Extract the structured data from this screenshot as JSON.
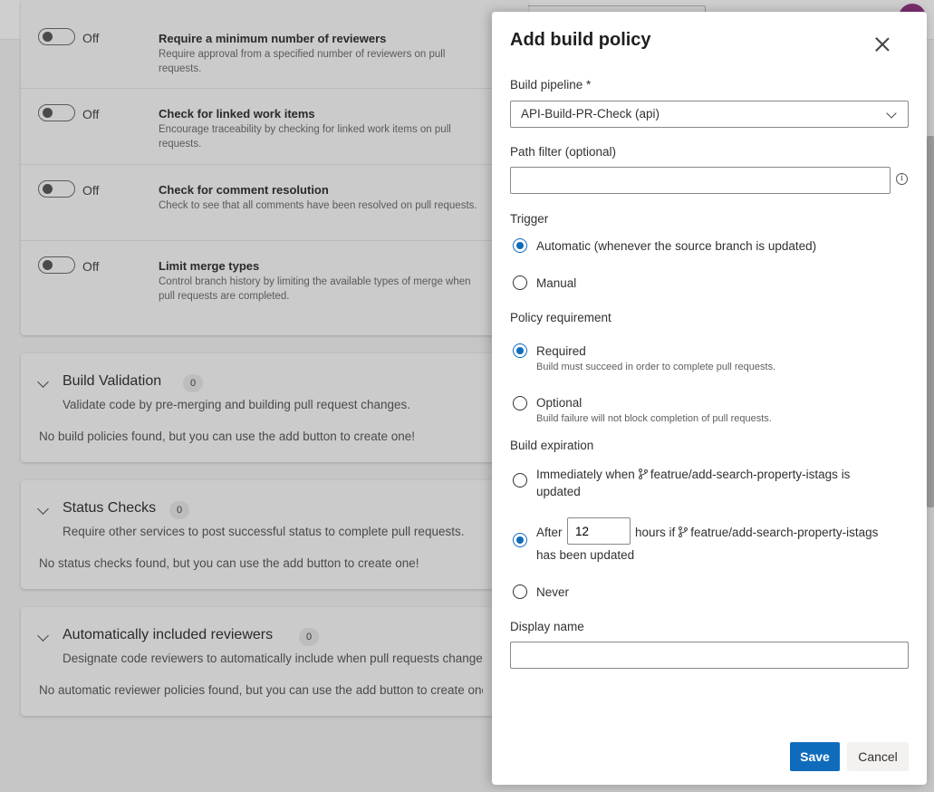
{
  "background": {
    "policies": [
      {
        "state": "Off",
        "title": "Require a minimum number of reviewers",
        "desc": "Require approval from a specified number of reviewers on pull requests."
      },
      {
        "state": "Off",
        "title": "Check for linked work items",
        "desc": "Encourage traceability by checking for linked work items on pull requests."
      },
      {
        "state": "Off",
        "title": "Check for comment resolution",
        "desc": "Check to see that all comments have been resolved on pull requests."
      },
      {
        "state": "Off",
        "title": "Limit merge types",
        "desc": "Control branch history by limiting the available types of merge when pull requests are completed."
      }
    ],
    "sections": [
      {
        "title": "Build Validation",
        "count": "0",
        "desc": "Validate code by pre-merging and building pull request changes.",
        "empty": "No build policies found, but you can use the add button to create one!"
      },
      {
        "title": "Status Checks",
        "count": "0",
        "desc": "Require other services to post successful status to complete pull requests.",
        "empty": "No status checks found, but you can use the add button to create one!"
      },
      {
        "title": "Automatically included reviewers",
        "count": "0",
        "desc": "Designate code reviewers to automatically include when pull requests change",
        "empty": "No automatic reviewer policies found, but you can use the add button to create one!"
      }
    ]
  },
  "dialog": {
    "title": "Add build policy",
    "build_pipeline_label": "Build pipeline *",
    "build_pipeline_value": "API-Build-PR-Check (api)",
    "path_filter_label": "Path filter (optional)",
    "path_filter_value": "",
    "trigger_label": "Trigger",
    "trigger_options": [
      {
        "label": "Automatic (whenever the source branch is updated)",
        "checked": true
      },
      {
        "label": "Manual",
        "checked": false
      }
    ],
    "policy_requirement_label": "Policy requirement",
    "requirement_options": [
      {
        "label": "Required",
        "sub": "Build must succeed in order to complete pull requests.",
        "checked": true
      },
      {
        "label": "Optional",
        "sub": "Build failure will not block completion of pull requests.",
        "checked": false
      }
    ],
    "build_expiration_label": "Build expiration",
    "expiration": {
      "immediately_prefix": "Immediately when",
      "branch": "featrue/add-search-property-istags",
      "immediately_suffix": "is",
      "immediately_line2": "updated",
      "after_prefix": "After",
      "hours_value": "12",
      "after_middle": "hours if",
      "after_line2": "has been updated",
      "never": "Never",
      "selected": "after"
    },
    "display_name_label": "Display name",
    "display_name_value": "",
    "save_label": "Save",
    "cancel_label": "Cancel"
  },
  "colors": {
    "accent": "#0f6cbd",
    "overlay": "#c6c6c6"
  }
}
